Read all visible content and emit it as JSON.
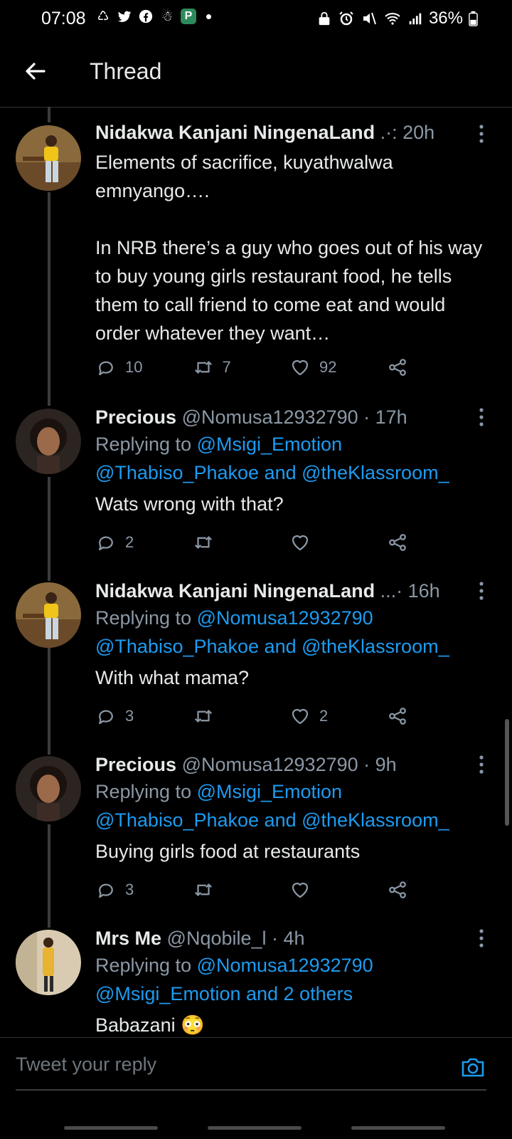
{
  "status": {
    "time": "07:08",
    "battery": "36%"
  },
  "header": {
    "title": "Thread"
  },
  "tweets": [
    {
      "name": "Nidakwa Kanjani NingenaLand",
      "handle": " .·: 20h",
      "text": "Elements of sacrifice, kuyathwalwa emnyango….\n\nIn NRB there’s a guy who goes out of his way to buy young girls restaurant food, he tells them to call friend to come eat and would order whatever they want…",
      "replies": "10",
      "retweets": "7",
      "likes": "92"
    },
    {
      "name": "Precious",
      "handle": " @Nomusa12932790 · 17h",
      "reply_prefix": "Replying to ",
      "reply_line1": "@Msigi_Emotion",
      "reply_line2": "@Thabiso_Phakoe and @theKlassroom_",
      "text": "Wats wrong with that?",
      "replies": "2",
      "retweets": "",
      "likes": ""
    },
    {
      "name": "Nidakwa Kanjani NingenaLand",
      "handle": " ...· 16h",
      "reply_prefix": "Replying to ",
      "reply_line1": "@Nomusa12932790",
      "reply_line2": "@Thabiso_Phakoe and @theKlassroom_",
      "text": "With what mama?",
      "replies": "3",
      "retweets": "",
      "likes": "2"
    },
    {
      "name": "Precious",
      "handle": " @Nomusa12932790 · 9h",
      "reply_prefix": "Replying to ",
      "reply_line1": "@Msigi_Emotion",
      "reply_line2": "@Thabiso_Phakoe and @theKlassroom_",
      "text": "Buying girls food at restaurants",
      "replies": "3",
      "retweets": "",
      "likes": ""
    },
    {
      "name": "Mrs Me",
      "handle": " @Nqobile_l · 4h",
      "reply_prefix": "Replying to ",
      "reply_line1": "@Nomusa12932790",
      "reply_line2": "@Msigi_Emotion and 2 others",
      "text": "Babazani 😳"
    }
  ],
  "composer": {
    "placeholder": "Tweet your reply"
  },
  "colors": {
    "accent": "#1d9bf0",
    "muted": "#8b98a5",
    "background": "#000000"
  },
  "icons": [
    "back-arrow-icon",
    "more-vertical-icon",
    "reply-icon",
    "retweet-icon",
    "like-icon",
    "share-icon",
    "camera-icon"
  ]
}
